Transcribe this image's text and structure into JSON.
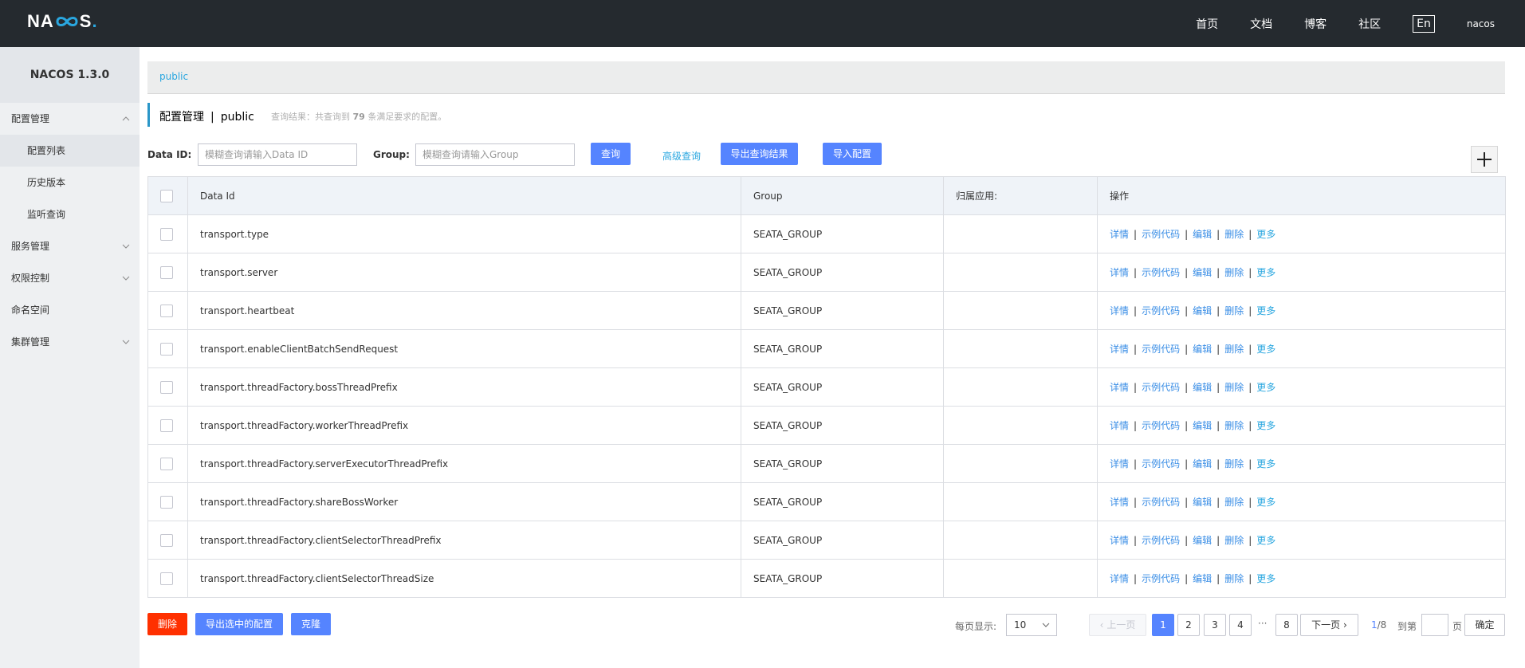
{
  "header": {
    "logo_text": "NACOS.",
    "nav": [
      "首页",
      "文档",
      "博客",
      "社区"
    ],
    "lang": "En",
    "user": "nacos"
  },
  "sidebar": {
    "version": "NACOS 1.3.0",
    "config_mgmt": "配置管理",
    "config_list": "配置列表",
    "history": "历史版本",
    "listener": "监听查询",
    "service_mgmt": "服务管理",
    "auth": "权限控制",
    "namespace": "命名空间",
    "cluster": "集群管理"
  },
  "breadcrumb": {
    "namespace": "public"
  },
  "title": {
    "main": "配置管理",
    "separator": "|",
    "ns": "public",
    "hint_prefix": "查询结果：共查询到",
    "hint_count": "79",
    "hint_suffix": "条满足要求的配置。"
  },
  "search": {
    "dataid_label": "Data ID:",
    "dataid_placeholder": "模糊查询请输入Data ID",
    "group_label": "Group:",
    "group_placeholder": "模糊查询请输入Group",
    "query_btn": "查询",
    "advanced": "高级查询",
    "export_btn": "导出查询结果",
    "import_btn": "导入配置"
  },
  "table": {
    "headers": [
      "Data Id",
      "Group",
      "归属应用:",
      "操作"
    ],
    "ops": [
      "详情",
      "示例代码",
      "编辑",
      "删除",
      "更多"
    ],
    "rows": [
      {
        "dataId": "transport.type",
        "group": "SEATA_GROUP",
        "app": ""
      },
      {
        "dataId": "transport.server",
        "group": "SEATA_GROUP",
        "app": ""
      },
      {
        "dataId": "transport.heartbeat",
        "group": "SEATA_GROUP",
        "app": ""
      },
      {
        "dataId": "transport.enableClientBatchSendRequest",
        "group": "SEATA_GROUP",
        "app": ""
      },
      {
        "dataId": "transport.threadFactory.bossThreadPrefix",
        "group": "SEATA_GROUP",
        "app": ""
      },
      {
        "dataId": "transport.threadFactory.workerThreadPrefix",
        "group": "SEATA_GROUP",
        "app": ""
      },
      {
        "dataId": "transport.threadFactory.serverExecutorThreadPrefix",
        "group": "SEATA_GROUP",
        "app": ""
      },
      {
        "dataId": "transport.threadFactory.shareBossWorker",
        "group": "SEATA_GROUP",
        "app": ""
      },
      {
        "dataId": "transport.threadFactory.clientSelectorThreadPrefix",
        "group": "SEATA_GROUP",
        "app": ""
      },
      {
        "dataId": "transport.threadFactory.clientSelectorThreadSize",
        "group": "SEATA_GROUP",
        "app": ""
      }
    ]
  },
  "bottom": {
    "delete_btn": "删除",
    "export_selected_btn": "导出选中的配置",
    "clone_btn": "克隆",
    "page_size_label": "每页显示:",
    "page_size": "10",
    "prev": "上一页",
    "pages": [
      "1",
      "2",
      "3",
      "4",
      "8"
    ],
    "ellipsis": "···",
    "next": "下一页",
    "page_info_current": "1",
    "page_info_total": "/8",
    "goto_label": "到第",
    "page_unit": "页",
    "confirm": "确定"
  }
}
